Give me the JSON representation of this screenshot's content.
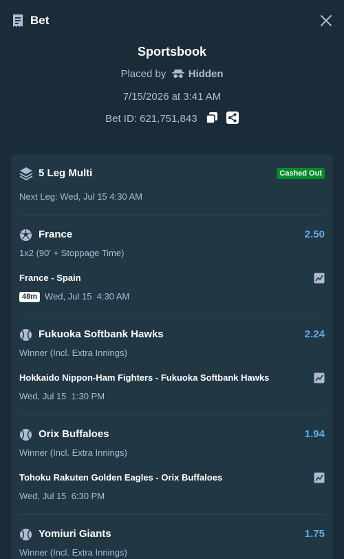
{
  "header": {
    "title": "Bet",
    "icon": "receipt-icon",
    "close_icon": "close-icon"
  },
  "summary": {
    "source": "Sportsbook",
    "placed_by_label": "Placed by",
    "placed_by_user": "Hidden",
    "datetime": "7/15/2026 at 3:41 AM",
    "bet_id_label": "Bet ID:",
    "bet_id": "621,751,843"
  },
  "bet": {
    "type_label": "5 Leg Multi",
    "status": "Cashed Out",
    "next_leg": "Next Leg: Wed, Jul 15 4:30 AM"
  },
  "legs": [
    {
      "selection": "France",
      "sport_icon": "soccer-ball-icon",
      "odds": "2.50",
      "market": "1x2 (90' + Stoppage Time)",
      "match": "France - Spain",
      "live_badge": "48m",
      "time": "Wed, Jul 15  4:30 AM"
    },
    {
      "selection": "Fukuoka Softbank Hawks",
      "sport_icon": "baseball-icon",
      "odds": "2.24",
      "market": "Winner (Incl. Extra Innings)",
      "match": "Hokkaido Nippon-Ham Fighters - Fukuoka Softbank Hawks",
      "time": "Wed, Jul 15  1:30 PM"
    },
    {
      "selection": "Orix Buffaloes",
      "sport_icon": "baseball-icon",
      "odds": "1.94",
      "market": "Winner (Incl. Extra Innings)",
      "match": "Tohoku Rakuten Golden Eagles - Orix Buffaloes",
      "time": "Wed, Jul 15  6:30 PM"
    },
    {
      "selection": "Yomiuri Giants",
      "sport_icon": "baseball-icon",
      "odds": "1.75",
      "market": "Winner (Incl. Extra Innings)"
    }
  ],
  "colors": {
    "background": "#1a2c38",
    "card": "#213743",
    "odds": "#61aeea",
    "status_badge": "#058b2b",
    "muted_text": "#b1bad3"
  }
}
